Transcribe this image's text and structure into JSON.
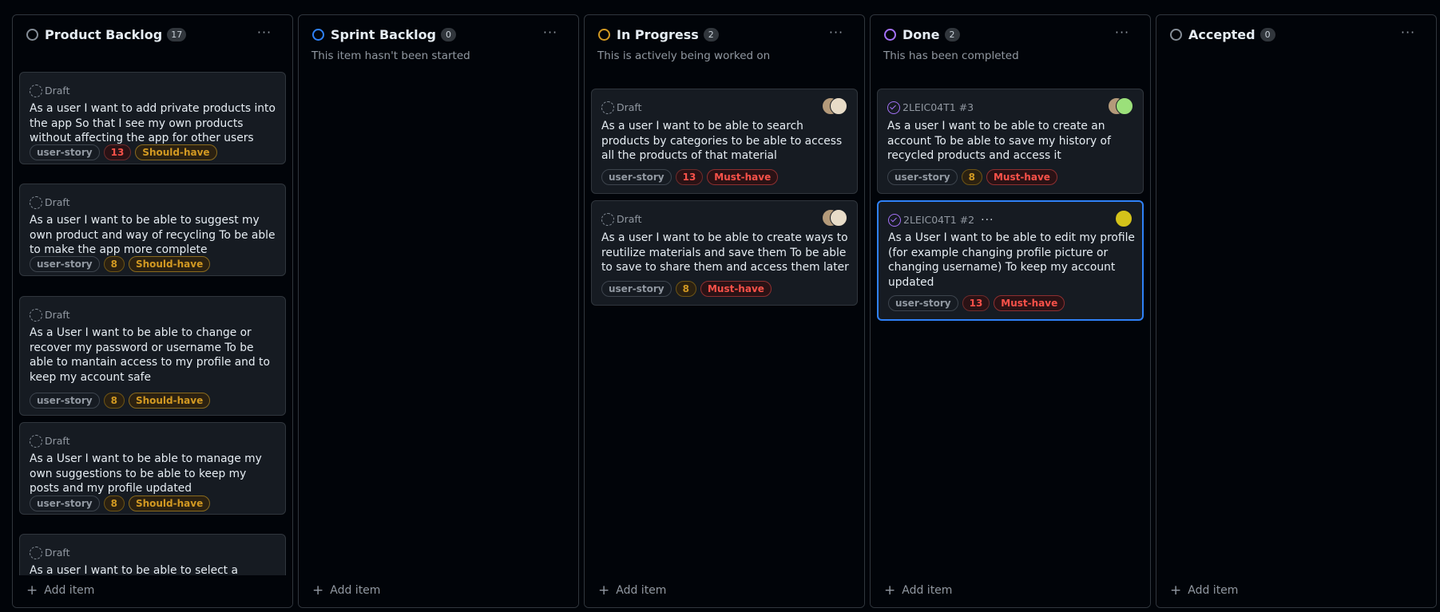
{
  "columns": [
    {
      "title": "Product Backlog",
      "count": "17",
      "status_color": "#848d97",
      "description": "",
      "cards": [
        {
          "meta": "Draft",
          "meta_kind": "draft",
          "title": "As a user I want to add private products into the app So that I see my own products without affecting the app for other users",
          "tags": [
            "user-story",
            "13",
            "Should-have"
          ],
          "avatars": []
        },
        {
          "meta": "Draft",
          "meta_kind": "draft",
          "title": "As a user I want to be able to suggest my own product and way of recycling To be able to make the app more complete",
          "tags": [
            "user-story",
            "8",
            "Should-have"
          ],
          "avatars": []
        },
        {
          "meta": "Draft",
          "meta_kind": "draft",
          "title": "As a User I want to be able to change or recover my password or username To be able to mantain access to my profile and to keep my account safe",
          "tags": [
            "user-story",
            "8",
            "Should-have"
          ],
          "avatars": []
        },
        {
          "meta": "Draft",
          "meta_kind": "draft",
          "title": "As a User I want to be able to manage my own suggestions to be able to keep my posts and my profile updated",
          "tags": [
            "user-story",
            "8",
            "Should-have"
          ],
          "avatars": []
        },
        {
          "meta": "Draft",
          "meta_kind": "draft",
          "title": "As a user I want to be able to select a certain type of disposable To be able to access",
          "tags": [],
          "avatars": []
        }
      ],
      "add_label": "Add item"
    },
    {
      "title": "Sprint Backlog",
      "count": "0",
      "status_color": "#2f81f7",
      "description": "This item hasn't been started",
      "cards": [],
      "add_label": "Add item"
    },
    {
      "title": "In Progress",
      "count": "2",
      "status_color": "#d29922",
      "description": "This is actively being worked on",
      "cards": [
        {
          "meta": "Draft",
          "meta_kind": "draft",
          "title": "As a user I want to be able to search products by categories to be able to access all the products of that material",
          "tags": [
            "user-story",
            "13",
            "Must-have"
          ],
          "avatars": [
            "avatar-1",
            "avatar-2"
          ]
        },
        {
          "meta": "Draft",
          "meta_kind": "draft",
          "title": "As a user I want to be able to create ways to reutilize materials and save them To be able to save to share them and access them later",
          "tags": [
            "user-story",
            "8",
            "Must-have"
          ],
          "avatars": [
            "avatar-1",
            "avatar-2"
          ]
        }
      ],
      "add_label": "Add item"
    },
    {
      "title": "Done",
      "count": "2",
      "status_color": "#a371f7",
      "description": "This has been completed",
      "cards": [
        {
          "meta": "2LEIC04T1 #3",
          "meta_kind": "done",
          "title": "As a user I want to be able to create an account To be able to save my history of recycled products and access it",
          "tags": [
            "user-story",
            "8",
            "Must-have"
          ],
          "avatars": [
            "avatar-1",
            "avatar-3"
          ]
        },
        {
          "meta": "2LEIC04T1 #2",
          "meta_kind": "done",
          "title": "As a User I want to be able to edit my profile (for example changing profile picture or changing username) To keep my account updated",
          "tags": [
            "user-story",
            "13",
            "Must-have"
          ],
          "avatars": [
            "avatar-4"
          ],
          "selected": true
        }
      ],
      "add_label": "Add item"
    },
    {
      "title": "Accepted",
      "count": "0",
      "status_color": "#848d97",
      "description": "",
      "cards": [],
      "add_label": "Add item"
    }
  ],
  "icons": {
    "menu": "kebab-horizontal-icon",
    "add": "plus-icon",
    "draft": "draft-issue-icon",
    "done": "closed-issue-icon"
  },
  "colors": {
    "background": "#010409",
    "card": "#161b22",
    "border": "#30363d",
    "accent": "#2f81f7",
    "must_have": "#f85149",
    "should_have": "#d29922"
  }
}
